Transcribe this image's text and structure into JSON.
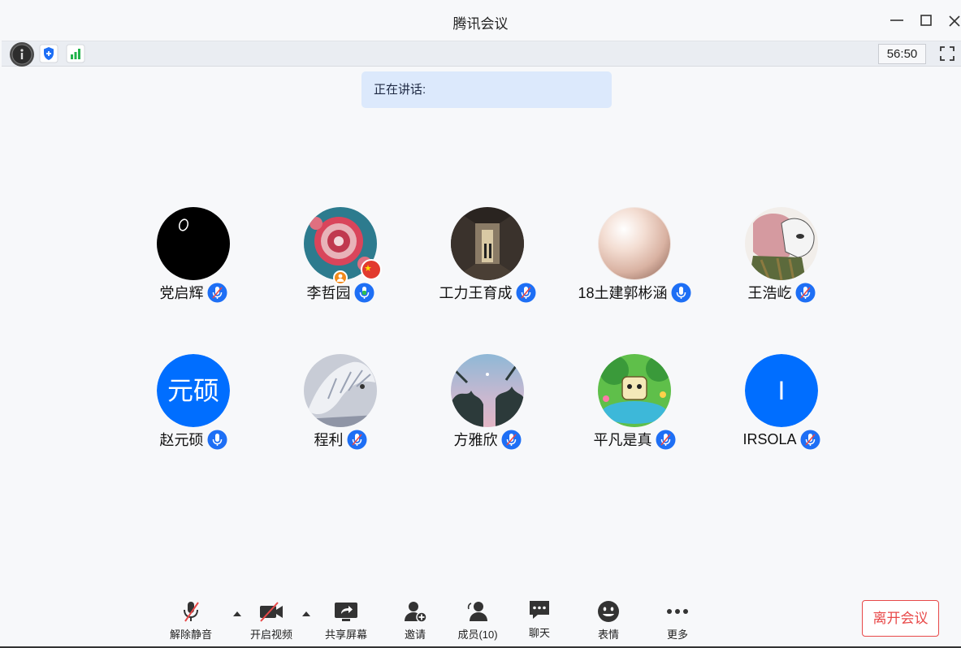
{
  "window": {
    "title": "腾讯会议"
  },
  "top_toolbar": {
    "timer": "56:50"
  },
  "speaking": {
    "label": "正在讲话:"
  },
  "participants": [
    {
      "name": "党启辉",
      "mic": "muted"
    },
    {
      "name": "李哲园",
      "mic": "active"
    },
    {
      "name": "工力王育成",
      "mic": "muted"
    },
    {
      "name": "18土建郭彬涵",
      "mic": "on"
    },
    {
      "name": "王浩屹",
      "mic": "muted"
    },
    {
      "name": "赵元硕",
      "mic": "on",
      "avatar_text": "元硕"
    },
    {
      "name": "程利",
      "mic": "muted"
    },
    {
      "name": "方雅欣",
      "mic": "muted"
    },
    {
      "name": "平凡是真",
      "mic": "muted"
    },
    {
      "name": "IRSOLA",
      "mic": "muted",
      "avatar_text": "I"
    }
  ],
  "controls": {
    "unmute": "解除静音",
    "start_video": "开启视频",
    "share_screen": "共享屏幕",
    "invite": "邀请",
    "members": "成员(10)",
    "chat": "聊天",
    "emoji": "表情",
    "more": "更多",
    "leave": "离开会议"
  },
  "colors": {
    "accent": "#006eff",
    "mic_icon": "#1e6ff5",
    "mic_active": "#2fbf4f",
    "mute_slash": "#e84848",
    "leave": "#e84848",
    "speaking_bg": "#dce9fc"
  }
}
